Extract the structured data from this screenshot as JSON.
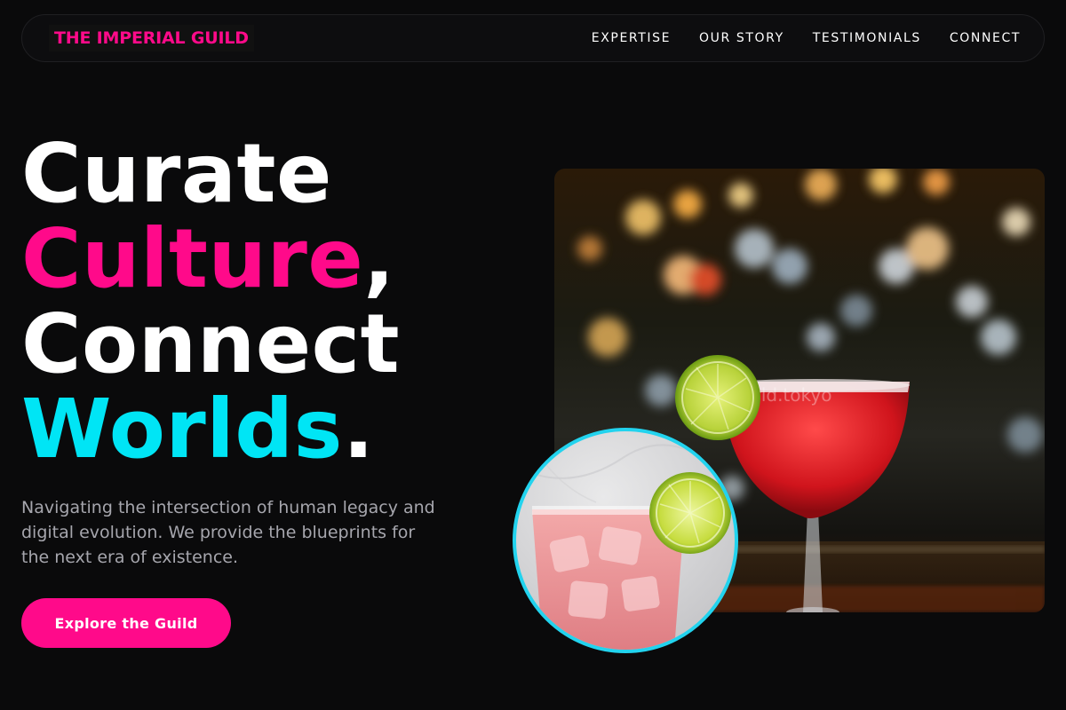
{
  "brand": {
    "name": "THE IMPERIAL GUILD"
  },
  "nav": {
    "items": [
      {
        "label": "EXPERTISE"
      },
      {
        "label": "OUR STORY"
      },
      {
        "label": "TESTIMONIALS"
      },
      {
        "label": "CONNECT"
      }
    ]
  },
  "hero": {
    "line1": "Curate",
    "line2_word": "Culture",
    "line2_punct": ",",
    "line3": "Connect",
    "line4_word": "Worlds",
    "line4_punct": ".",
    "subtitle": "Navigating the intersection of human legacy and digital evolution. We provide the blueprints for the next era of existence.",
    "cta_label": "Explore the Guild"
  },
  "colors": {
    "background": "#0a0a0b",
    "accent_pink": "#ff0a8a",
    "accent_cyan": "#00e5f5",
    "text_muted": "#a6a6ad"
  },
  "images": {
    "main": {
      "subject": "red margarita cocktail with lime wedge, bokeh bar background",
      "watermark": "world.tokyo"
    },
    "round": {
      "subject": "pink iced drink in glass with lime slice"
    }
  }
}
